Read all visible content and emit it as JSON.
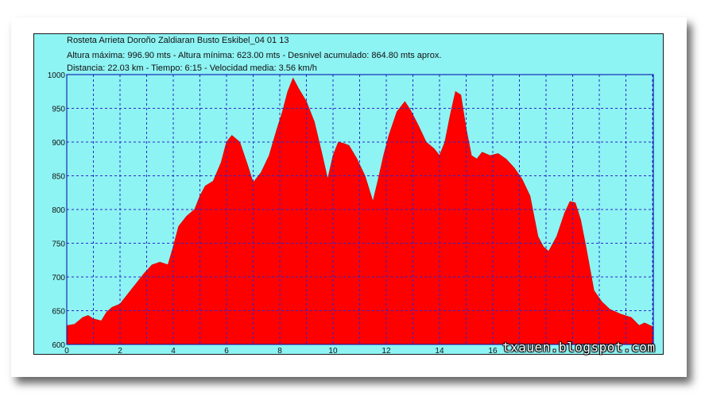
{
  "header": {
    "line1": "Rosteta Arrieta Doroño Zaldiaran Busto Eskibel_04 01 13",
    "line2": "Altura máxima: 996.90 mts - Altura mínima: 623.00 mts - Desnivel acumulado: 864.80 mts aprox.",
    "line3": "Distancia: 22.03 km - Tiempo: 6:15 - Velocidad media: 3.56 km/h"
  },
  "watermark": "txauen.blogspot.com",
  "colors": {
    "fill": "#ff0000",
    "grid": "#2a2acc",
    "background": "#8ef3f3"
  },
  "chart_data": {
    "type": "area",
    "title": "",
    "xlabel": "",
    "ylabel": "",
    "xlim": [
      0,
      22.03
    ],
    "ylim": [
      600,
      1000
    ],
    "xticks": [
      "0",
      "2",
      "4",
      "6",
      "8",
      "10",
      "12",
      "14",
      "16"
    ],
    "yticks": [
      "600",
      "650",
      "700",
      "750",
      "800",
      "850",
      "900",
      "950",
      "1000"
    ],
    "grid": true,
    "series": [
      {
        "x": [
          0,
          0.3,
          0.6,
          0.8,
          1.0,
          1.3,
          1.5,
          1.7,
          2.0,
          2.3,
          2.6,
          2.9,
          3.2,
          3.5,
          3.8,
          4.0,
          4.2,
          4.5,
          4.8,
          5.0,
          5.2,
          5.5,
          5.8,
          6.0,
          6.2,
          6.5,
          6.8,
          7.0,
          7.3,
          7.6,
          7.9,
          8.1,
          8.3,
          8.5,
          8.7,
          9.0,
          9.3,
          9.6,
          9.8,
          10.0,
          10.2,
          10.4,
          10.6,
          10.9,
          11.2,
          11.5,
          11.7,
          11.9,
          12.1,
          12.4,
          12.7,
          12.9,
          13.2,
          13.5,
          13.8,
          14.0,
          14.2,
          14.4,
          14.6,
          14.8,
          15.0,
          15.2,
          15.4,
          15.6,
          15.9,
          16.2,
          16.5,
          16.8,
          17.1,
          17.4,
          17.7,
          17.9,
          18.1,
          18.4,
          18.7,
          18.9,
          19.1,
          19.3,
          19.5,
          19.8,
          20.1,
          20.4,
          20.8,
          21.2,
          21.5,
          21.7,
          22.03
        ],
        "y": [
          628,
          630,
          640,
          643,
          638,
          635,
          648,
          655,
          660,
          675,
          690,
          705,
          718,
          722,
          718,
          745,
          775,
          790,
          800,
          820,
          835,
          842,
          870,
          900,
          910,
          900,
          865,
          840,
          855,
          880,
          920,
          945,
          975,
          995,
          980,
          960,
          930,
          880,
          845,
          880,
          900,
          898,
          895,
          875,
          850,
          812,
          845,
          880,
          910,
          945,
          960,
          948,
          925,
          900,
          890,
          880,
          900,
          940,
          975,
          970,
          920,
          880,
          875,
          885,
          880,
          883,
          875,
          862,
          845,
          820,
          760,
          745,
          738,
          760,
          795,
          812,
          810,
          785,
          745,
          680,
          663,
          652,
          645,
          640,
          628,
          632,
          626
        ]
      }
    ]
  }
}
